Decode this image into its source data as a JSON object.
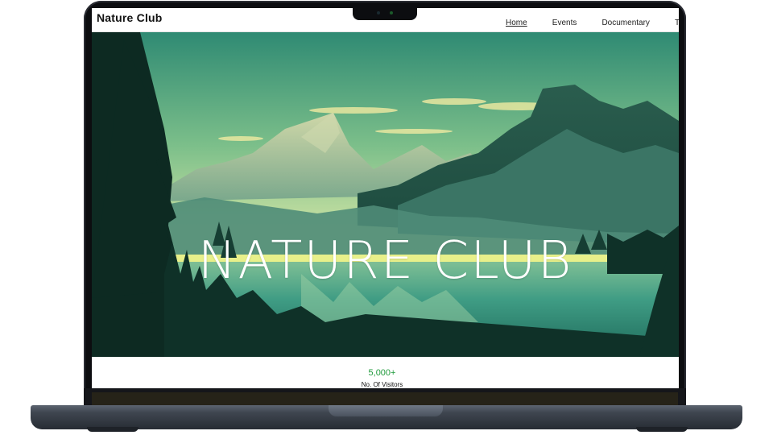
{
  "site": {
    "brand": "Nature Club"
  },
  "nav": {
    "items": [
      {
        "label": "Home",
        "active": true
      },
      {
        "label": "Events",
        "active": false
      },
      {
        "label": "Documentary",
        "active": false
      },
      {
        "label": "Te",
        "active": false
      }
    ]
  },
  "hero": {
    "title": "NATURE CLUB"
  },
  "stats": {
    "visitors_value": "5,000+",
    "visitors_label": "No. Of Visitors"
  },
  "colors": {
    "accent_green": "#1f9a3b",
    "laptop_body": "#3f4650"
  }
}
